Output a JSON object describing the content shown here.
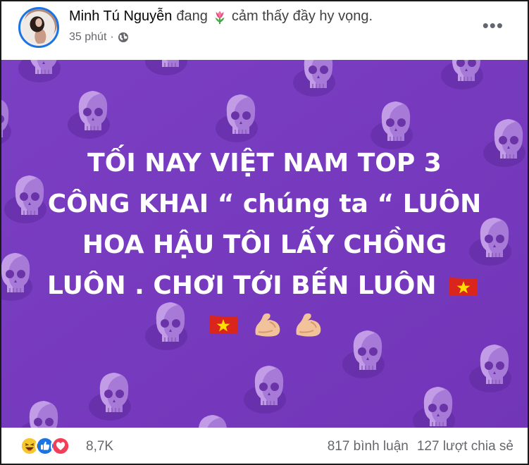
{
  "post": {
    "author": "Minh Tú Nguyễn",
    "feeling_prefix": "đang",
    "feeling_text": "cảm thấy đầy hy vọng.",
    "time": "35 phút",
    "separator": "·",
    "more": "•••",
    "image_lines": [
      "TỐI NAY VIỆT NAM TOP 3",
      "CÔNG KHAI “ chúng ta “ LUÔN",
      "HOA HẬU TÔI LẤY CHỒNG",
      "LUÔN . CHƠI TỚI BẾN LUÔN"
    ],
    "icons": {
      "feeling": "tulip-icon",
      "privacy": "globe-icon",
      "flag": "vietnam-flag-icon",
      "muscle": "flexed-biceps-icon"
    }
  },
  "footer": {
    "reaction_count": "8,7K",
    "comments": "817 bình luận",
    "shares": "127 lượt chia sẻ",
    "reactions": [
      "haha",
      "like",
      "love"
    ]
  },
  "colors": {
    "background_purple": "#7a3fc0",
    "like_blue": "#1b74e4",
    "love_red": "#f33e58",
    "haha_yellow": "#f7c72e"
  }
}
